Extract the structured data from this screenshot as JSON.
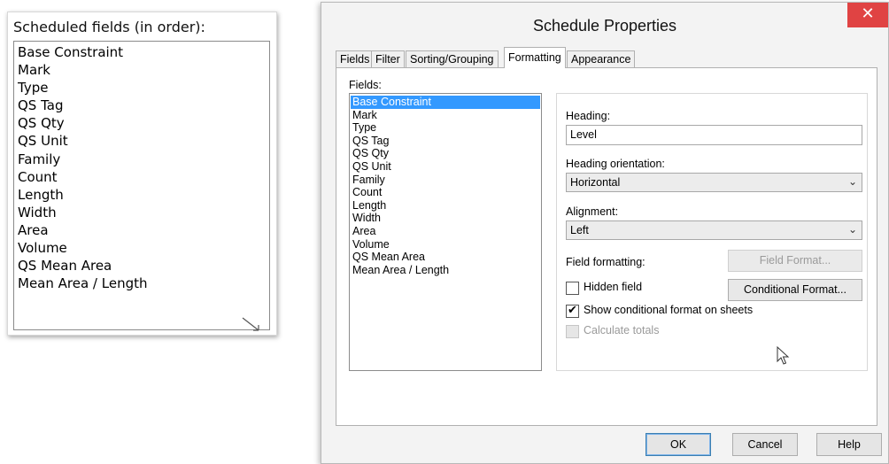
{
  "left_panel": {
    "title": "Scheduled fields (in order):",
    "fields": [
      "Base Constraint",
      "Mark",
      "Type",
      "QS Tag",
      "QS Qty",
      "QS Unit",
      "Family",
      "Count",
      "Length",
      "Width",
      "Area",
      "Volume",
      "QS Mean Area",
      "Mean Area / Length"
    ]
  },
  "dialog": {
    "title": "Schedule Properties",
    "close_glyph": "✕",
    "tabs": [
      {
        "label": "Fields"
      },
      {
        "label": "Filter"
      },
      {
        "label": "Sorting/Grouping"
      },
      {
        "label": "Formatting",
        "active": true
      },
      {
        "label": "Appearance"
      }
    ],
    "fields_label": "Fields:",
    "fields": [
      "Base Constraint",
      "Mark",
      "Type",
      "QS Tag",
      "QS Qty",
      "QS Unit",
      "Family",
      "Count",
      "Length",
      "Width",
      "Area",
      "Volume",
      "QS Mean Area",
      "Mean Area / Length"
    ],
    "selected_field": "Base Constraint",
    "heading_label": "Heading:",
    "heading_value": "Level",
    "orientation_label": "Heading orientation:",
    "orientation_value": "Horizontal",
    "alignment_label": "Alignment:",
    "alignment_value": "Left",
    "field_formatting_label": "Field formatting:",
    "field_format_button": "Field Format...",
    "hidden_field_label": "Hidden field",
    "hidden_field_checked": false,
    "conditional_format_button": "Conditional  Format...",
    "show_conditional_label": "Show conditional format on sheets",
    "show_conditional_checked": true,
    "calculate_totals_label": "Calculate totals",
    "calculate_totals_checked": false,
    "check_glyph": "✔",
    "chevron_glyph": "⌄",
    "footer": {
      "ok": "OK",
      "cancel": "Cancel",
      "help": "Help"
    }
  }
}
